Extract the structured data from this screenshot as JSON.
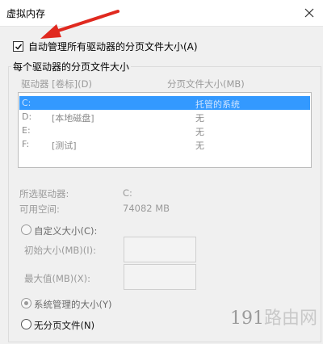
{
  "window": {
    "title": "虚拟内存"
  },
  "auto_manage": {
    "label": "自动管理所有驱动器的分页文件大小(A)",
    "checked": true
  },
  "group": {
    "legend": "每个驱动器的分页文件大小",
    "columns": {
      "drive": "驱动器 [卷标](D)",
      "size": "分页文件大小(MB)"
    },
    "drives": [
      {
        "drive": "C:",
        "label": "",
        "size": "托管的系统",
        "selected": true
      },
      {
        "drive": "D:",
        "label": "[本地磁盘]",
        "size": "无",
        "selected": false
      },
      {
        "drive": "E:",
        "label": "",
        "size": "无",
        "selected": false
      },
      {
        "drive": "F:",
        "label": "[测试]",
        "size": "无",
        "selected": false
      }
    ]
  },
  "selected_drive": {
    "drive_label": "所选驱动器:",
    "drive_value": "C:",
    "space_label": "可用空间:",
    "space_value": "74082 MB"
  },
  "custom_size": {
    "radio_label": "自定义大小(C):",
    "initial_label": "初始大小(MB)(I):",
    "max_label": "最大值(MB)(X):"
  },
  "system_managed": {
    "radio_label": "系统管理的大小(Y)",
    "selected": true
  },
  "no_paging": {
    "radio_label": "无分页文件(N)"
  },
  "watermark": {
    "part_a": "191",
    "part_b": "路由网"
  },
  "colors": {
    "selection": "#3399ff",
    "arrow": "#e0291f"
  }
}
